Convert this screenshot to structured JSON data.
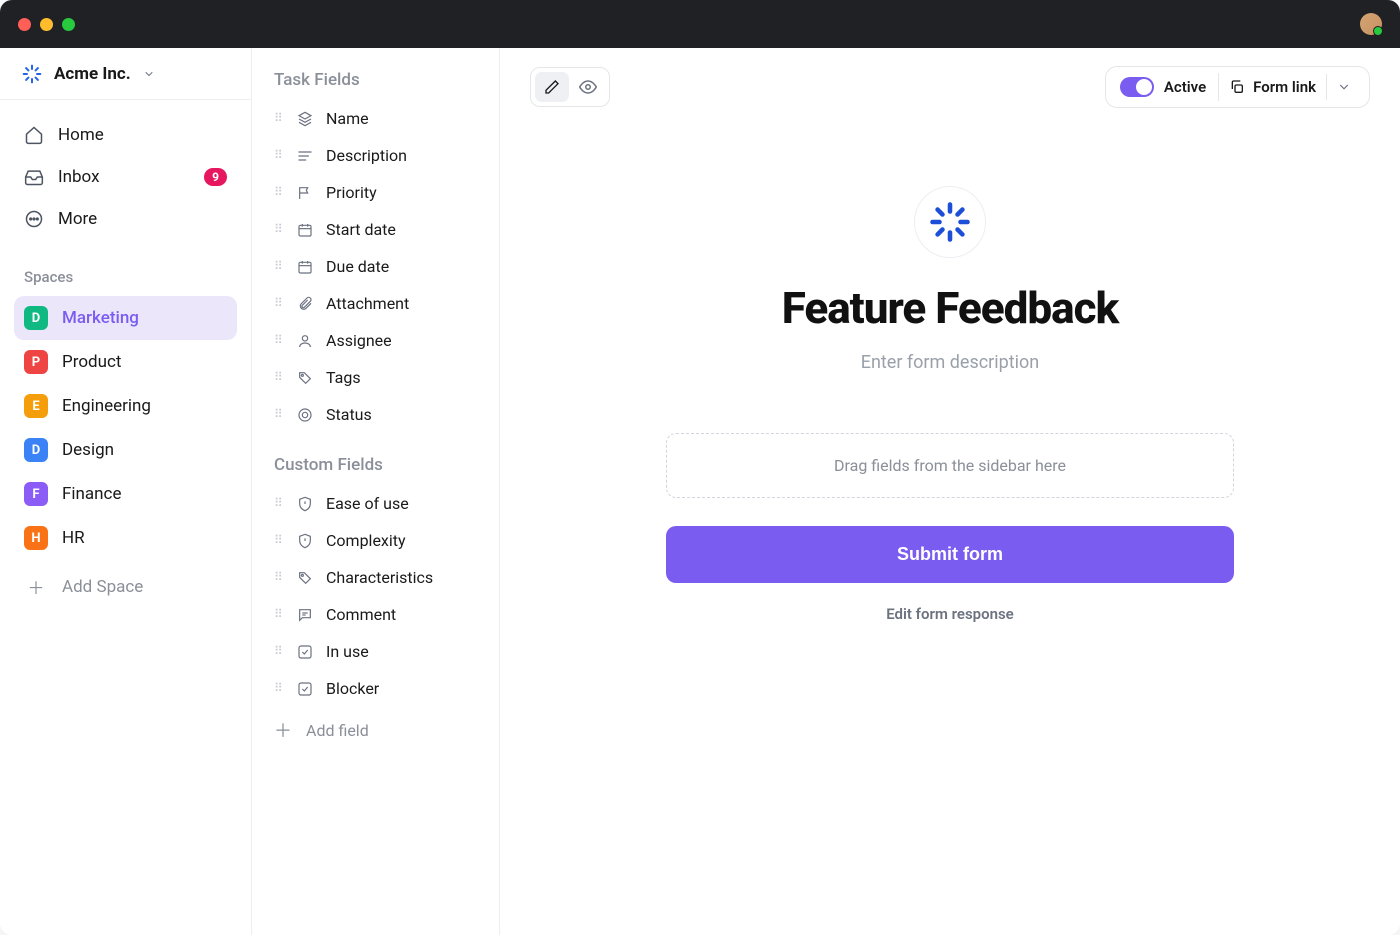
{
  "workspace": {
    "name": "Acme Inc."
  },
  "nav": {
    "home": "Home",
    "inbox": "Inbox",
    "inbox_badge": "9",
    "more": "More"
  },
  "spaces": {
    "label": "Spaces",
    "items": [
      {
        "letter": "D",
        "color": "#10b981",
        "label": "Marketing",
        "active": true
      },
      {
        "letter": "P",
        "color": "#ef4444",
        "label": "Product"
      },
      {
        "letter": "E",
        "color": "#f59e0b",
        "label": "Engineering"
      },
      {
        "letter": "D",
        "color": "#3b82f6",
        "label": "Design"
      },
      {
        "letter": "F",
        "color": "#8b5cf6",
        "label": "Finance"
      },
      {
        "letter": "H",
        "color": "#f97316",
        "label": "HR"
      }
    ],
    "add": "Add Space"
  },
  "fields": {
    "task_label": "Task Fields",
    "task_items": [
      {
        "icon": "layers",
        "label": "Name"
      },
      {
        "icon": "lines",
        "label": "Description"
      },
      {
        "icon": "flag",
        "label": "Priority"
      },
      {
        "icon": "calendar",
        "label": "Start date"
      },
      {
        "icon": "calendar",
        "label": "Due date"
      },
      {
        "icon": "clip",
        "label": "Attachment"
      },
      {
        "icon": "person",
        "label": "Assignee"
      },
      {
        "icon": "tag",
        "label": "Tags"
      },
      {
        "icon": "target",
        "label": "Status"
      }
    ],
    "custom_label": "Custom Fields",
    "custom_items": [
      {
        "icon": "shield",
        "label": "Ease of use"
      },
      {
        "icon": "shield",
        "label": "Complexity"
      },
      {
        "icon": "tag",
        "label": "Characteristics"
      },
      {
        "icon": "comment",
        "label": "Comment"
      },
      {
        "icon": "check",
        "label": "In use"
      },
      {
        "icon": "check",
        "label": "Blocker"
      }
    ],
    "add": "Add field"
  },
  "toolbar": {
    "active_label": "Active",
    "formlink_label": "Form link"
  },
  "form": {
    "title": "Feature Feedback",
    "description_placeholder": "Enter form description",
    "dropzone": "Drag fields from the sidebar here",
    "submit": "Submit form",
    "edit_response": "Edit form response"
  }
}
